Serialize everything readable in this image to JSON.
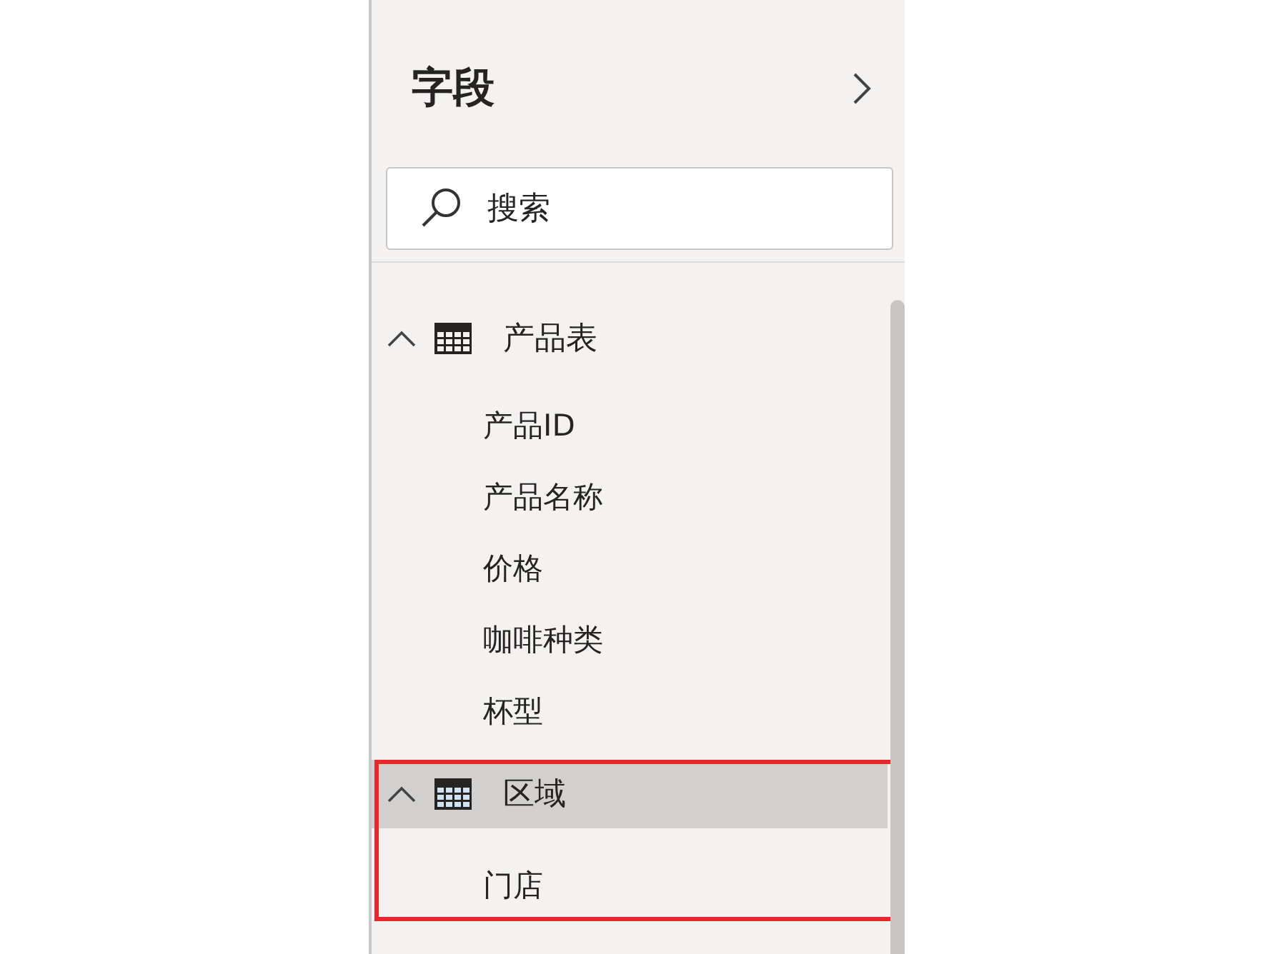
{
  "pane": {
    "title": "字段",
    "search": {
      "placeholder": "搜索"
    }
  },
  "tables": [
    {
      "name": "产品表",
      "expanded": true,
      "selected": false,
      "highlighted": false,
      "fields": [
        "产品ID",
        "产品名称",
        "价格",
        "咖啡种类",
        "杯型"
      ]
    },
    {
      "name": "区域",
      "expanded": true,
      "selected": true,
      "highlighted": true,
      "fields": [
        "门店"
      ]
    }
  ]
}
